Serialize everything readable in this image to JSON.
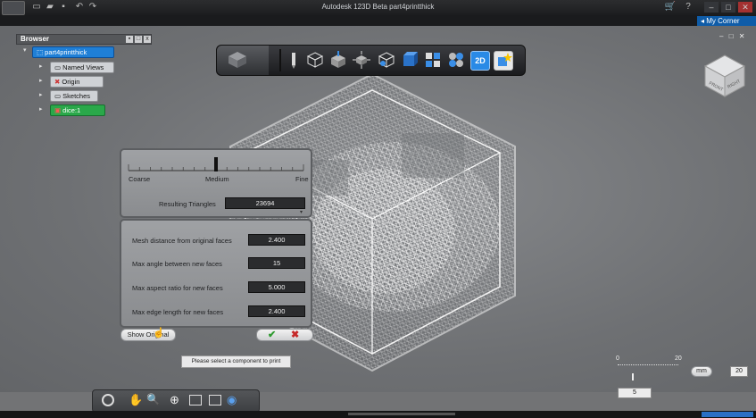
{
  "window": {
    "title": "Autodesk 123D Beta   part4printthick",
    "my_corner": "My Corner"
  },
  "browser": {
    "title": "Browser",
    "tree": [
      {
        "label": "part4printthick"
      },
      {
        "label": "Named Views"
      },
      {
        "label": "Origin"
      },
      {
        "label": "Sketches"
      },
      {
        "label": "dice:1"
      }
    ]
  },
  "viewcube": {
    "front": "FRONT",
    "right": "RIGHT"
  },
  "toolbar": {
    "icons": [
      "home-cube-icon",
      "pencil-icon",
      "box-icon",
      "cube-move-icon",
      "transform-icon",
      "sphere-cube-icon",
      "solid-box-icon",
      "grid-icon",
      "pattern-icon",
      "2d-icon",
      "star-box-icon"
    ],
    "btn_2d": "2D"
  },
  "mesh": {
    "slider_labels": {
      "coarse": "Coarse",
      "medium": "Medium",
      "fine": "Fine"
    },
    "slider_position": 0.5,
    "resulting_triangles_label": "Resulting Triangles",
    "resulting_triangles_value": "23694",
    "params": [
      {
        "label": "Mesh distance from original faces",
        "value": "2.400"
      },
      {
        "label": "Max angle between new faces",
        "value": "15"
      },
      {
        "label": "Max aspect ratio for new faces",
        "value": "5.000"
      },
      {
        "label": "Max edge length for new faces",
        "value": "2.400"
      }
    ],
    "show_original": "Show Original",
    "ok_icon": "check-icon",
    "cancel_icon": "x-icon"
  },
  "tooltip": "Please select a component to print",
  "scale": {
    "tick0": "0",
    "tick20": "20",
    "unit": "mm",
    "value_right": "20",
    "value_bottom": "5"
  },
  "colors": {
    "accent": "#0f5ca8",
    "ok": "#2e9a2e",
    "cancel": "#c62828",
    "selected": "#1f7fd6",
    "highlight_green": "#2aa84a"
  }
}
